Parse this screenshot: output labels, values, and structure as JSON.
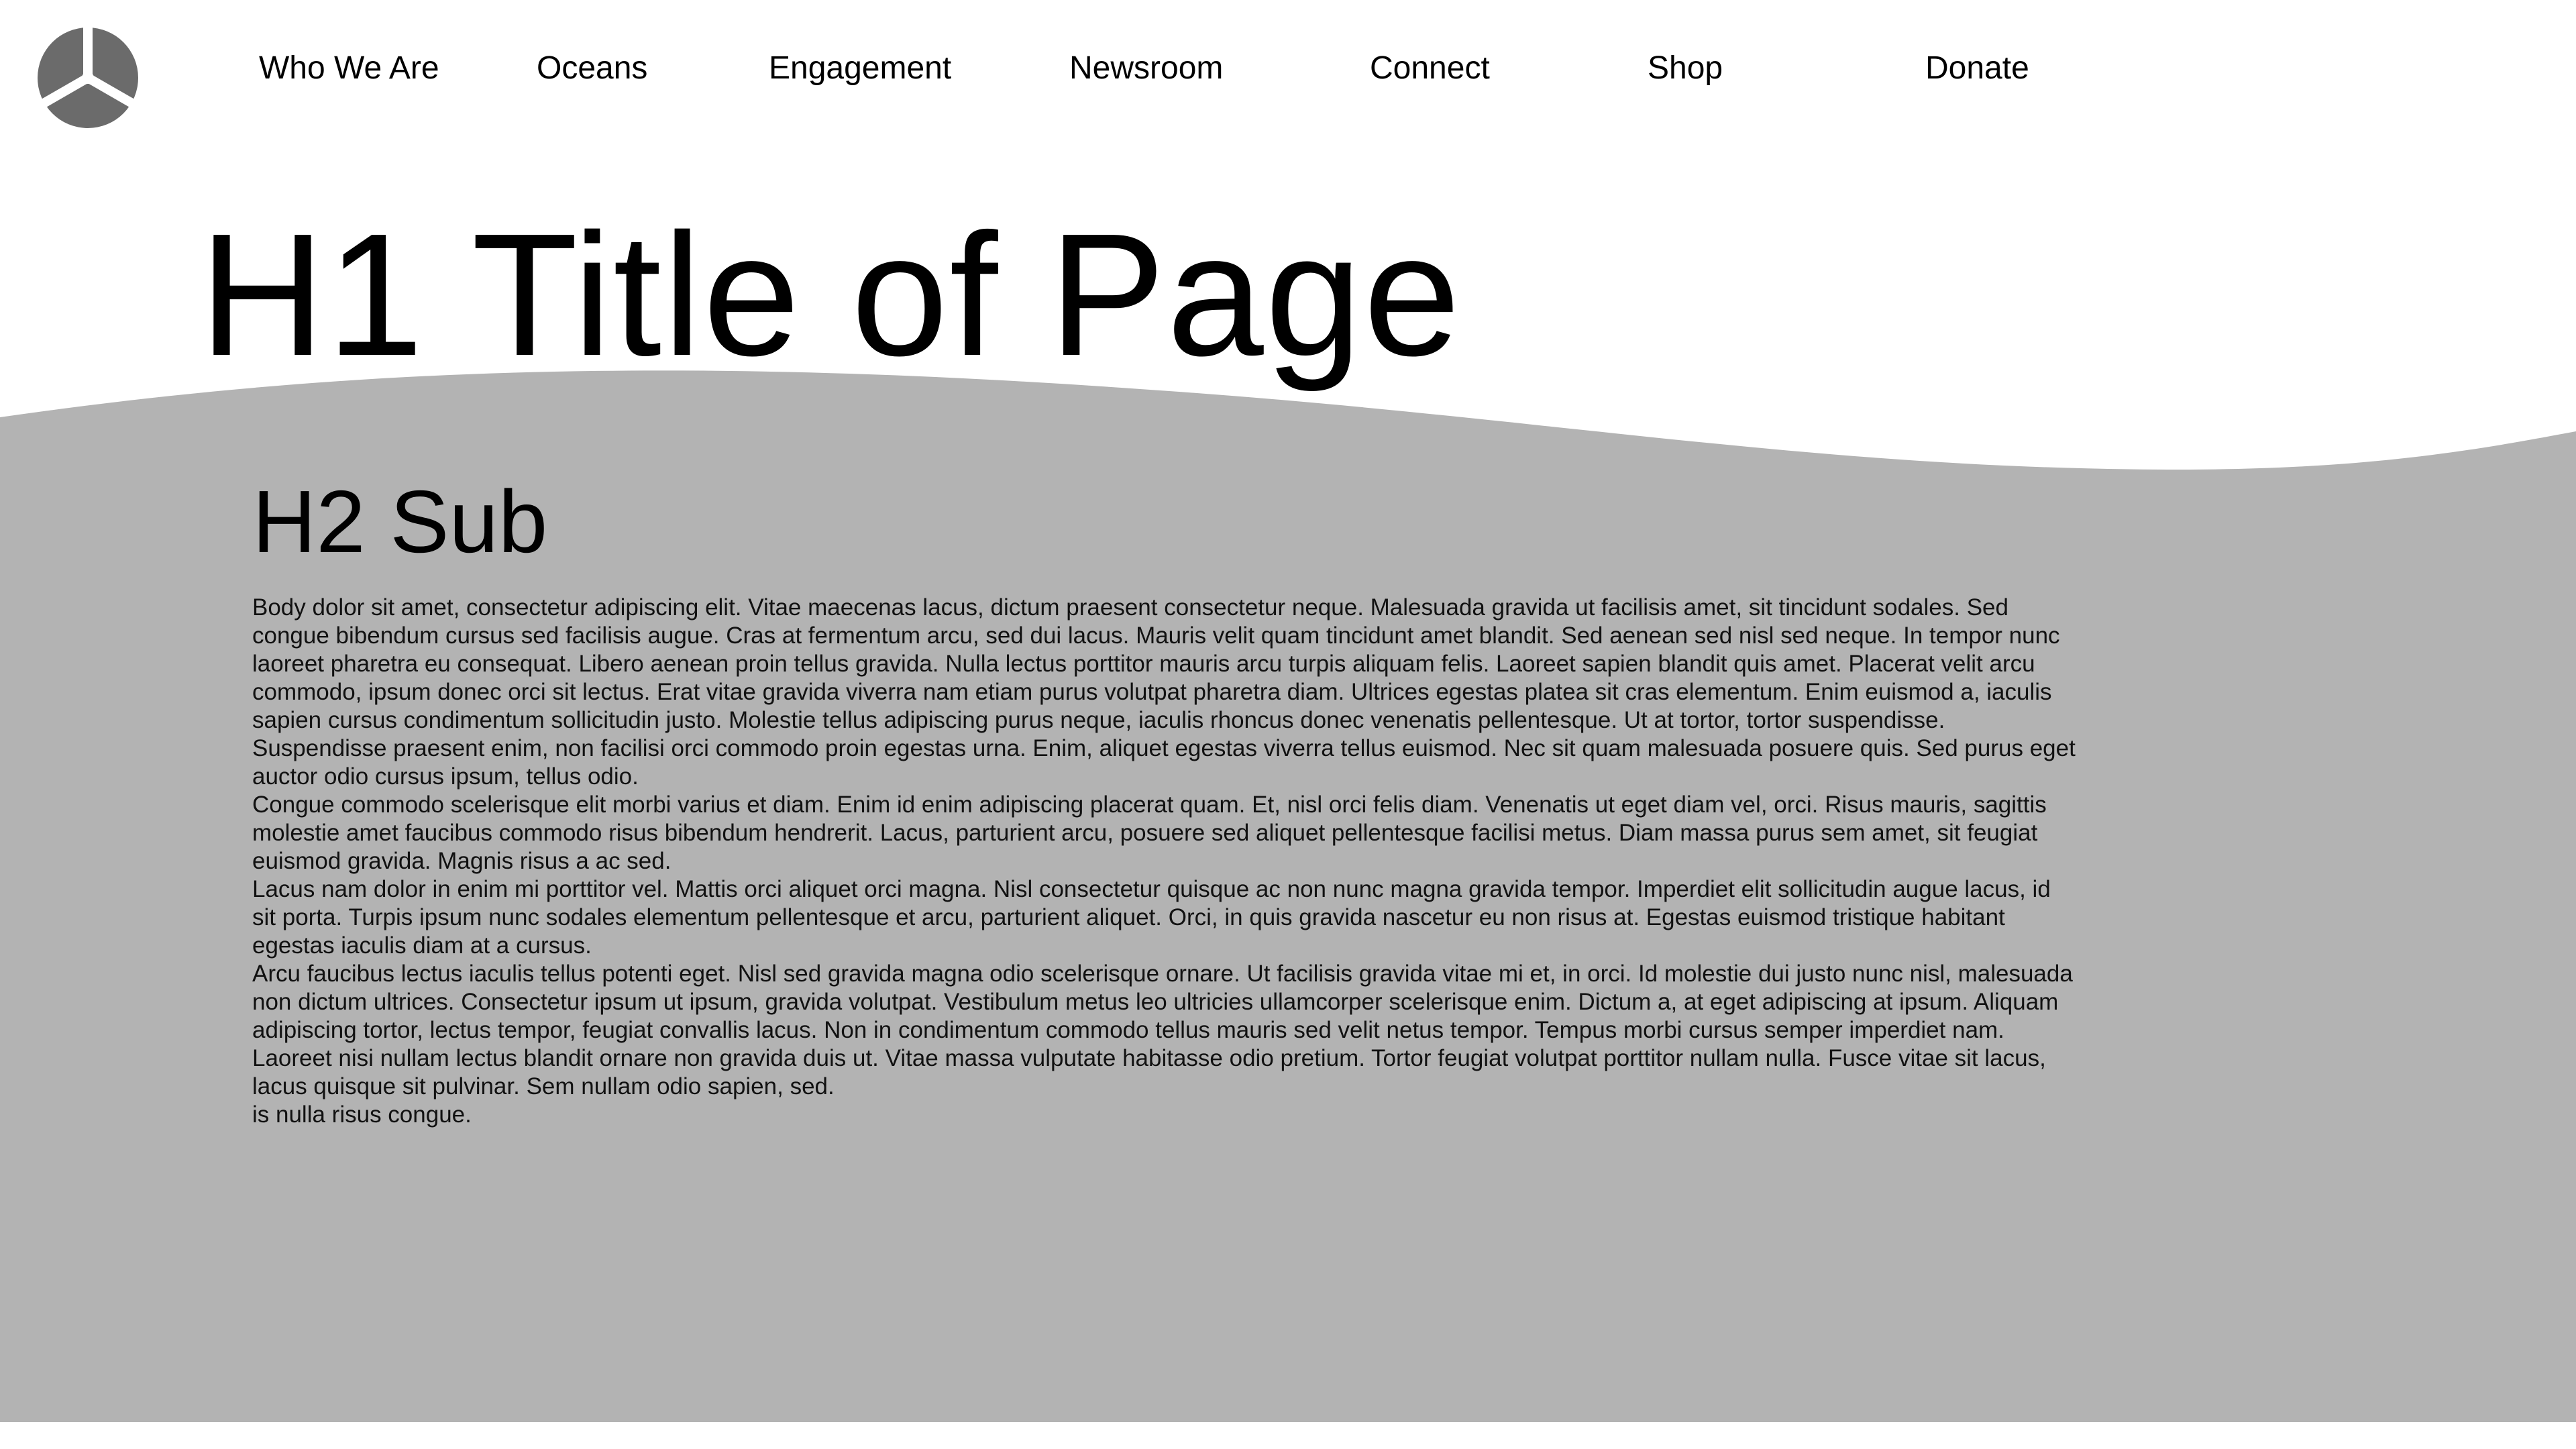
{
  "nav": {
    "logo_icon": "tri-blade-circle-icon",
    "items": [
      {
        "label": "Who We Are"
      },
      {
        "label": "Oceans"
      },
      {
        "label": "Engagement"
      },
      {
        "label": "Newsroom"
      },
      {
        "label": "Connect"
      },
      {
        "label": "Shop"
      },
      {
        "label": "Donate"
      }
    ]
  },
  "hero": {
    "title": "H1 Title of Page"
  },
  "content": {
    "subtitle": "H2 Sub",
    "paragraphs": [
      "Body dolor sit amet, consectetur adipiscing elit. Vitae maecenas lacus, dictum praesent consectetur neque. Malesuada gravida ut facilisis amet, sit tincidunt sodales. Sed congue bibendum cursus sed facilisis augue. Cras at fermentum arcu, sed dui lacus. Mauris velit quam tincidunt amet blandit. Sed aenean sed nisl sed neque. In tempor nunc laoreet pharetra eu consequat. Libero aenean proin tellus gravida. Nulla lectus porttitor mauris arcu turpis aliquam felis. Laoreet sapien blandit quis amet. Placerat velit arcu commodo, ipsum donec orci sit lectus. Erat vitae gravida viverra nam etiam purus volutpat pharetra diam. Ultrices egestas platea sit cras elementum. Enim euismod a, iaculis sapien cursus condimentum sollicitudin justo. Molestie tellus adipiscing purus neque, iaculis rhoncus donec venenatis pellentesque. Ut at tortor, tortor suspendisse. Suspendisse praesent enim, non facilisi orci commodo proin egestas urna. Enim, aliquet egestas viverra tellus euismod. Nec sit quam malesuada posuere quis. Sed purus eget auctor odio cursus ipsum, tellus odio.",
      "Congue commodo scelerisque elit morbi varius et diam. Enim id enim adipiscing placerat quam. Et, nisl orci felis diam. Venenatis ut eget diam vel, orci. Risus mauris, sagittis molestie amet faucibus commodo risus bibendum hendrerit. Lacus, parturient arcu, posuere sed aliquet pellentesque facilisi metus. Diam massa purus sem amet, sit feugiat euismod gravida. Magnis risus a ac sed.",
      "Lacus nam dolor in enim mi porttitor vel. Mattis orci aliquet orci magna. Nisl consectetur quisque ac non nunc magna gravida tempor. Imperdiet elit sollicitudin augue lacus, id sit porta. Turpis ipsum nunc sodales elementum pellentesque et arcu, parturient aliquet. Orci, in quis gravida nascetur eu non risus at. Egestas euismod tristique habitant egestas iaculis diam at a cursus.",
      "Arcu faucibus lectus iaculis tellus potenti eget. Nisl sed gravida magna odio scelerisque ornare. Ut facilisis gravida vitae mi et, in orci. Id molestie dui justo nunc nisl, malesuada non dictum ultrices. Consectetur ipsum ut ipsum, gravida volutpat. Vestibulum metus leo ultricies ullamcorper scelerisque enim. Dictum a, at eget adipiscing at ipsum. Aliquam adipiscing tortor, lectus tempor, feugiat convallis lacus. Non in condimentum commodo tellus mauris sed velit netus tempor. Tempus morbi cursus semper imperdiet nam. Laoreet nisi nullam lectus blandit ornare non gravida duis ut. Vitae massa vulputate habitasse odio pretium. Tortor feugiat volutpat porttitor nullam nulla. Fusce vitae sit lacus, lacus quisque sit pulvinar. Sem nullam odio sapien, sed.",
      "is nulla risus congue."
    ]
  },
  "colors": {
    "page_background": "#ffffff",
    "wave_section": "#b3b3b3",
    "logo": "#6b6b6b",
    "text": "#000000"
  }
}
